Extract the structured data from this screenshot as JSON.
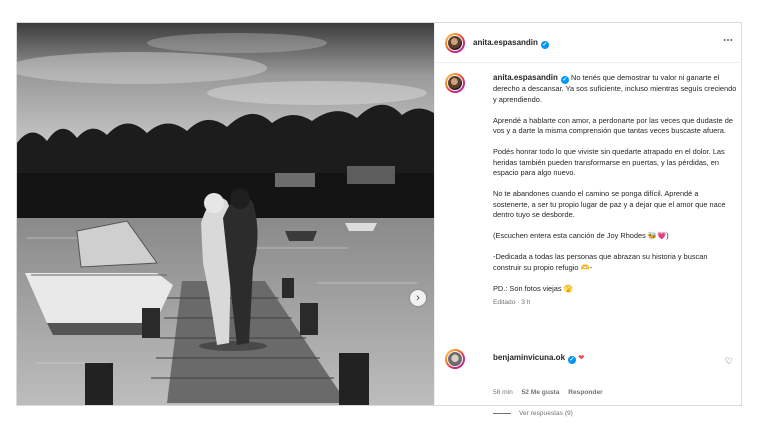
{
  "post": {
    "author": "anita.espasandin",
    "more_icon": "⋯",
    "next_icon": "›",
    "caption": {
      "author": "anita.espasandin",
      "first": "No tenés que demostrar tu valor ni ganarte el derecho a descansar. Ya sos suficiente, incluso mientras seguís creciendo y aprendiendo.",
      "p2": "Aprendé a hablarte con amor, a perdonarte por las veces que dudaste de vos y a darte la misma comprensión que tantas veces buscaste afuera.",
      "p3": "Podés honrar todo lo que viviste sin quedarte atrapado en el dolor. Las heridas también pueden transformarse en puertas, y las pérdidas, en espacio para algo nuevo.",
      "p4": "No te abandones cuando el camino se ponga difícil. Aprendé a sostenerte, a ser tu propio lugar de paz y a dejar que el amor que nace dentro tuyo se desborde.",
      "p5": "(Escuchen entera esta canción de Joy Rhodes 🐝💗)",
      "p6": "-Dedicada a todas las personas que abrazan su historia y buscan construir su propio refugio 🫶-",
      "p7": "PD.: Son fotos viejas 🫣",
      "edited": "Editado · 3 h"
    },
    "comment": {
      "author": "benjaminvicuna.ok",
      "text": "❤",
      "time": "58 min",
      "likes": "52 Me gusta",
      "reply": "Responder",
      "view_replies": "Ver respuestas (9)",
      "like_icon": "♡"
    }
  }
}
